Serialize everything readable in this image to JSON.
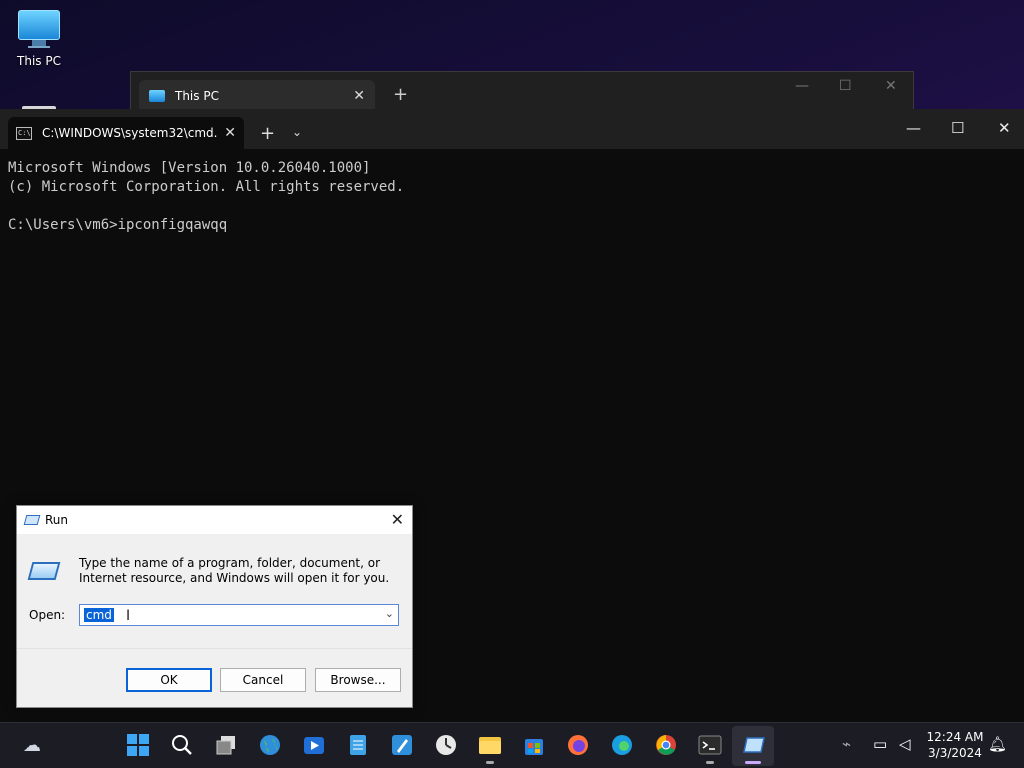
{
  "desktop": {
    "icon_label": "This PC"
  },
  "explorer": {
    "tab_title": "This PC",
    "new_tab": "+",
    "minimize": "—",
    "maximize": "☐",
    "close": "✕",
    "tab_close": "✕"
  },
  "terminal": {
    "tab_title": "C:\\WINDOWS\\system32\\cmd.",
    "tab_close": "✕",
    "new_tab": "+",
    "dropdown": "⌄",
    "minimize": "—",
    "maximize": "☐",
    "close": "✕",
    "lines": [
      "Microsoft Windows [Version 10.0.26040.1000]",
      "(c) Microsoft Corporation. All rights reserved.",
      "",
      "C:\\Users\\vm6>ipconfigqawqq"
    ]
  },
  "run_dialog": {
    "title": "Run",
    "close": "✕",
    "description": "Type the name of a program, folder, document, or Internet resource, and Windows will open it for you.",
    "open_label": "Open:",
    "open_value": "cmd",
    "ok_label": "OK",
    "cancel_label": "Cancel",
    "browse_label": "Browse..."
  },
  "taskbar": {
    "clock_time": "12:24 AM",
    "clock_date": "3/3/2024",
    "icons": {
      "weather": "weather-icon",
      "start": "windows-start-icon",
      "search": "search-icon",
      "task_view": "task-view-icon",
      "globe": "globe-icon",
      "app": "media-app-icon",
      "notepad": "notepad-icon",
      "paint": "paint-icon",
      "clock_app": "clock-app-icon",
      "explorer": "file-explorer-icon",
      "store": "store-icon",
      "firefox": "firefox-icon",
      "edge": "edge-icon",
      "chrome": "chrome-icon",
      "terminal": "terminal-icon",
      "run": "run-icon"
    }
  },
  "colors": {
    "accent": "#0a64d8",
    "terminal_bg": "#0c0c0c",
    "titlebar_bg": "#202020"
  }
}
